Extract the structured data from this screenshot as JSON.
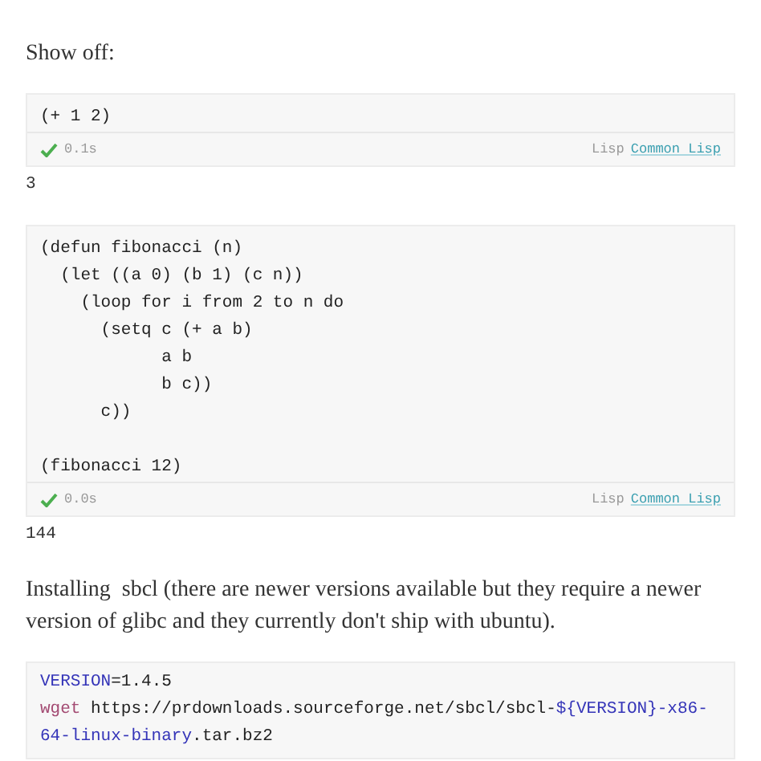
{
  "blocks": [
    {
      "kind": "paragraph",
      "text": "Show off:"
    },
    {
      "kind": "cell",
      "groups": [
        [
          "(+ 1 2)"
        ]
      ],
      "status": {
        "ok": true,
        "time": "0.1s",
        "language": "Lisp",
        "kernel": "Common Lisp"
      }
    },
    {
      "kind": "output",
      "text": "3"
    },
    {
      "kind": "cell",
      "groups": [
        [
          "(defun fibonacci (n)",
          "  (let ((a 0) (b 1) (c n))",
          "    (loop for i from 2 to n do",
          "      (setq c (+ a b)",
          "            a b",
          "            b c))",
          "      c))"
        ],
        [
          "(fibonacci 12)"
        ]
      ],
      "status": {
        "ok": true,
        "time": "0.0s",
        "language": "Lisp",
        "kernel": "Common Lisp"
      }
    },
    {
      "kind": "output",
      "text": "144"
    },
    {
      "kind": "paragraph",
      "text": "Installing  sbcl (there are newer versions available but they require a newer version of glibc and they currently don't ship with ubuntu)."
    },
    {
      "kind": "shell",
      "lines": [
        {
          "tokens": [
            {
              "kind": "variable",
              "text": "VERSION"
            },
            {
              "kind": "plain",
              "text": "=1.4.5"
            }
          ]
        },
        {
          "tokens": [
            {
              "kind": "builtin",
              "text": "wget"
            },
            {
              "kind": "plain",
              "text": " https://prdownloads.sourceforge.net/sbcl/sbcl-"
            },
            {
              "kind": "variable",
              "text": "${VERSION}-x86-64-linux-binary"
            },
            {
              "kind": "plain",
              "text": ".tar.bz2"
            }
          ]
        }
      ]
    }
  ]
}
